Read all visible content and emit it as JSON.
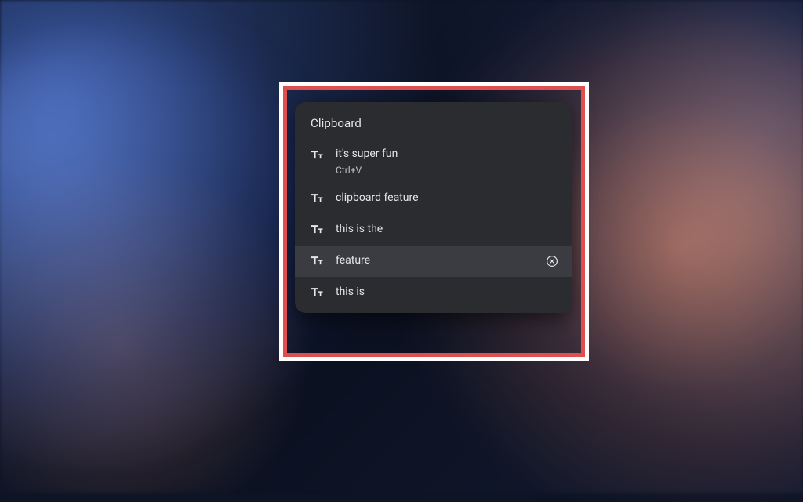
{
  "clipboard": {
    "title": "Clipboard",
    "items": [
      {
        "text": "it's super fun",
        "shortcut": "Ctrl+V",
        "hovered": false
      },
      {
        "text": "clipboard feature",
        "shortcut": null,
        "hovered": false
      },
      {
        "text": "this is the",
        "shortcut": null,
        "hovered": false
      },
      {
        "text": "feature",
        "shortcut": null,
        "hovered": true
      },
      {
        "text": "this is",
        "shortcut": null,
        "hovered": false
      }
    ]
  },
  "colors": {
    "panel_bg": "#2b2c30",
    "item_hover_bg": "#3a3c41",
    "text_primary": "#e6e7e9",
    "highlight_outer": "#ffffff",
    "highlight_inner": "#e04f4f"
  }
}
